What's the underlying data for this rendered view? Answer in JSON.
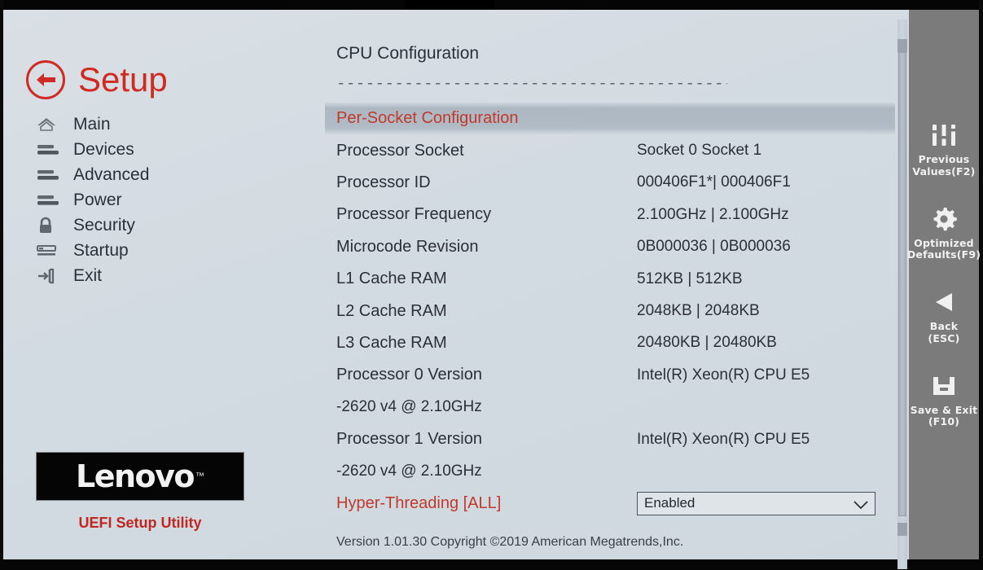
{
  "app": {
    "title": "Setup",
    "back_icon": "back-arrow-icon",
    "brand": "Lenovo",
    "brand_tm": "™",
    "brand_caption": "UEFI Setup Utility",
    "version_line": "Version 1.01.30 Copyright ©2019 American Megatrends,Inc."
  },
  "colors": {
    "accent_red": "#c0392b",
    "logo_red": "#cf2b22",
    "text": "#2b3038",
    "panel_gray": "#7b7b7b",
    "surface": "#d3dbe2"
  },
  "sidebar": {
    "items": [
      {
        "label": "Main",
        "icon": "home-icon"
      },
      {
        "label": "Devices",
        "icon": "devices-bars-icon"
      },
      {
        "label": "Advanced",
        "icon": "advanced-bars-icon"
      },
      {
        "label": "Power",
        "icon": "power-bars-icon"
      },
      {
        "label": "Security",
        "icon": "lock-icon"
      },
      {
        "label": "Startup",
        "icon": "startup-list-icon"
      },
      {
        "label": "Exit",
        "icon": "exit-arrow-icon"
      }
    ]
  },
  "main": {
    "heading": "CPU Configuration",
    "divider": "------------------------------------------------",
    "rows": [
      {
        "label": "Per-Socket Configuration",
        "value": "",
        "accent": true,
        "highlight": true
      },
      {
        "label": "Processor Socket",
        "value": "Socket 0   Socket 1"
      },
      {
        "label": "Processor ID",
        "value": "000406F1*| 000406F1"
      },
      {
        "label": "Processor Frequency",
        "value": "2.100GHz | 2.100GHz"
      },
      {
        "label": "Microcode Revision",
        "value": "0B000036 | 0B000036"
      },
      {
        "label": "L1 Cache RAM",
        "value": "512KB |   512KB"
      },
      {
        "label": "L2 Cache RAM",
        "value": "2048KB |  2048KB"
      },
      {
        "label": "L3 Cache RAM",
        "value": "20480KB | 20480KB"
      },
      {
        "label": "Processor 0 Version",
        "value": "Intel(R) Xeon(R) CPU E5"
      },
      {
        "continuation": "-2620 v4 @ 2.10GHz"
      },
      {
        "label": "Processor 1 Version",
        "value": "Intel(R) Xeon(R) CPU E5"
      },
      {
        "continuation": "-2620 v4 @ 2.10GHz"
      },
      {
        "label": "Hyper-Threading [ALL]",
        "accent": true,
        "control": "dropdown",
        "control_value": "Enabled"
      }
    ]
  },
  "actions": [
    {
      "label": "Previous\nValues(F2)",
      "line1": "Previous",
      "line2": "Values(F2)",
      "icon": "sliders-icon"
    },
    {
      "label": "Optimized\nDefaults(F9)",
      "line1": "Optimized",
      "line2": "Defaults(F9)",
      "icon": "gear-icon"
    },
    {
      "label": "Back\n(ESC)",
      "line1": "Back",
      "line2": "(ESC)",
      "icon": "back-triangle-icon"
    },
    {
      "label": "Save & Exit\n(F10)",
      "line1": "Save & Exit",
      "line2": "(F10)",
      "icon": "save-disk-icon"
    }
  ]
}
